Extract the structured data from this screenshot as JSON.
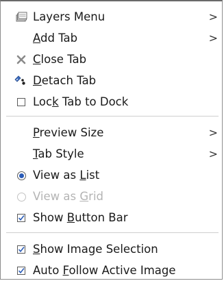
{
  "menu": {
    "items": [
      {
        "label_pre": "",
        "label_u": "",
        "label_post": "Layers Menu",
        "icon": "layers-icon",
        "submenu": true,
        "arrow": ">"
      },
      {
        "label_pre": "",
        "label_u": "A",
        "label_post": "dd Tab",
        "icon": "",
        "submenu": true,
        "arrow": ">"
      },
      {
        "label_pre": "",
        "label_u": "C",
        "label_post": "lose Tab",
        "icon": "close-icon",
        "submenu": false
      },
      {
        "label_pre": "",
        "label_u": "D",
        "label_post": "etach Tab",
        "icon": "detach-icon",
        "submenu": false
      },
      {
        "label_pre": "Loc",
        "label_u": "k",
        "label_post": " Tab to Dock",
        "icon": "checkbox-unchecked",
        "submenu": false
      },
      {
        "label_pre": "",
        "label_u": "P",
        "label_post": "review Size",
        "icon": "",
        "submenu": true,
        "arrow": ">"
      },
      {
        "label_pre": "",
        "label_u": "T",
        "label_post": "ab Style",
        "icon": "",
        "submenu": true,
        "arrow": ">"
      },
      {
        "label_pre": "View as ",
        "label_u": "L",
        "label_post": "ist",
        "icon": "radio-selected",
        "submenu": false
      },
      {
        "label_pre": "View as ",
        "label_u": "G",
        "label_post": "rid",
        "icon": "radio-unselected",
        "submenu": false,
        "disabled": true
      },
      {
        "label_pre": "Show ",
        "label_u": "B",
        "label_post": "utton Bar",
        "icon": "checkbox-checked",
        "submenu": false
      },
      {
        "label_pre": "",
        "label_u": "S",
        "label_post": "how Image Selection",
        "icon": "checkbox-checked",
        "submenu": false
      },
      {
        "label_pre": "Auto ",
        "label_u": "F",
        "label_post": "ollow Active Image",
        "icon": "checkbox-checked",
        "submenu": false
      }
    ]
  },
  "colors": {
    "text": "#1a1a1a",
    "disabled": "#b4b4b4",
    "separator": "#cfcfcf",
    "accent": "#2a5cb8"
  }
}
